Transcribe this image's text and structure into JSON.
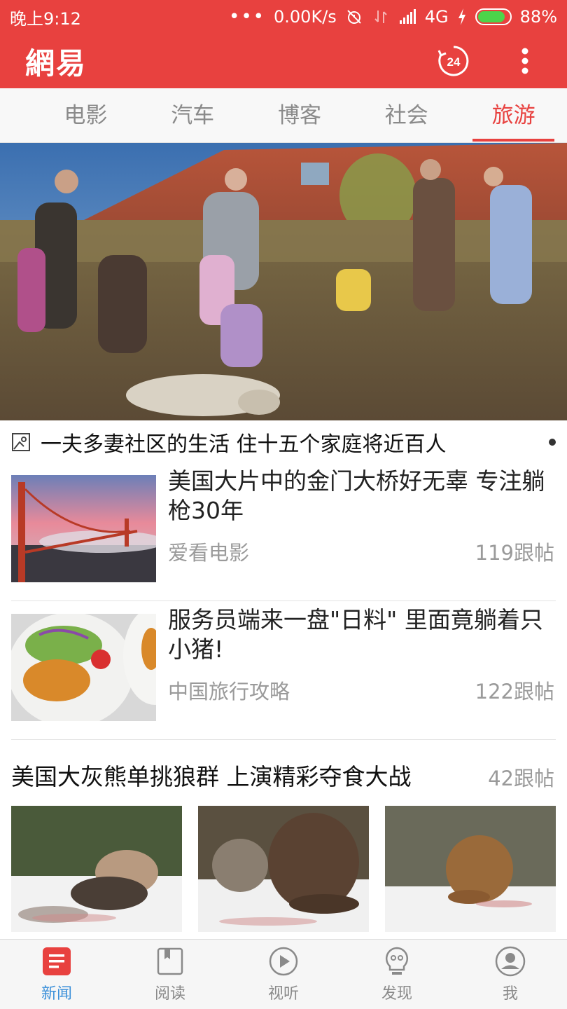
{
  "status_bar": {
    "time": "晚上9:12",
    "dots": "•••",
    "network_speed": "0.00K/s",
    "network_type": "4G",
    "battery_percent": "88%",
    "battery_level": 0.88,
    "icons": [
      "alarm-off-icon",
      "data-arrows-icon",
      "signal-icon",
      "charging-icon",
      "battery-icon"
    ]
  },
  "header": {
    "logo": "網易",
    "live_badge": "24",
    "icons": [
      "24h-clock-icon",
      "more-vertical-icon"
    ]
  },
  "tabs": [
    {
      "label": "电影",
      "active": false
    },
    {
      "label": "汽车",
      "active": false
    },
    {
      "label": "博客",
      "active": false
    },
    {
      "label": "社会",
      "active": false
    },
    {
      "label": "旅游",
      "active": true
    }
  ],
  "hero": {
    "caption": "一夫多妻社区的生活 住十五个家庭将近百人",
    "icon": "gallery-image-icon"
  },
  "news": [
    {
      "title": "美国大片中的金门大桥好无辜 专注躺枪30年",
      "source": "爱看电影",
      "replies": "119跟帖"
    },
    {
      "title": "服务员端来一盘\"日料\" 里面竟躺着只小猪!",
      "source": "中国旅行攻略",
      "replies": "122跟帖"
    }
  ],
  "gallery": {
    "title": "美国大灰熊单挑狼群 上演精彩夺食大战",
    "replies": "42跟帖"
  },
  "bottom_nav": [
    {
      "label": "新闻",
      "icon": "news-icon",
      "active": true
    },
    {
      "label": "阅读",
      "icon": "read-icon",
      "active": false
    },
    {
      "label": "视听",
      "icon": "play-icon",
      "active": false
    },
    {
      "label": "发现",
      "icon": "discover-bulb-icon",
      "active": false
    },
    {
      "label": "我",
      "icon": "profile-icon",
      "active": false
    }
  ],
  "colors": {
    "brand_red": "#e8413f",
    "active_blue": "#3a8fd9",
    "muted_gray": "#9a9a9a"
  }
}
